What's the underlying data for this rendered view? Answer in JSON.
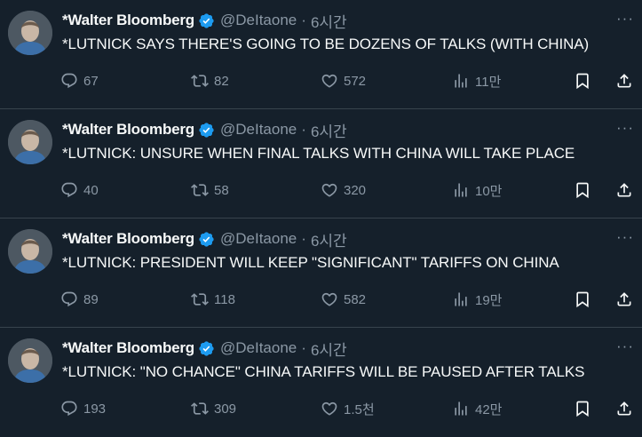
{
  "colors": {
    "background": "#15202b",
    "divider": "#38444d",
    "primary_text": "#f7f9f9",
    "secondary_text": "#8b98a5",
    "verified_badge": "#1d9bf0"
  },
  "icons": {
    "reply": "reply-icon",
    "retweet": "retweet-icon",
    "like": "heart-icon",
    "views": "views-icon",
    "bookmark": "bookmark-icon",
    "share": "share-icon",
    "more": "more-icon",
    "verified": "verified-badge-icon"
  },
  "more_label": "···",
  "tweets": [
    {
      "author_name": "*Walter Bloomberg",
      "handle": "@DeItaone",
      "separator": "·",
      "time": "6시간",
      "text": "*LUTNICK SAYS THERE'S GOING TO BE DOZENS OF TALKS (WITH CHINA)",
      "replies": "67",
      "retweets": "82",
      "likes": "572",
      "views": "11만"
    },
    {
      "author_name": "*Walter Bloomberg",
      "handle": "@DeItaone",
      "separator": "·",
      "time": "6시간",
      "text": "*LUTNICK: UNSURE WHEN FINAL TALKS WITH CHINA WILL TAKE PLACE",
      "replies": "40",
      "retweets": "58",
      "likes": "320",
      "views": "10만"
    },
    {
      "author_name": "*Walter Bloomberg",
      "handle": "@DeItaone",
      "separator": "·",
      "time": "6시간",
      "text": "*LUTNICK: PRESIDENT WILL KEEP \"SIGNIFICANT\" TARIFFS ON CHINA",
      "replies": "89",
      "retweets": "118",
      "likes": "582",
      "views": "19만"
    },
    {
      "author_name": "*Walter Bloomberg",
      "handle": "@DeItaone",
      "separator": "·",
      "time": "6시간",
      "text": "*LUTNICK: \"NO CHANCE\" CHINA TARIFFS WILL BE PAUSED AFTER TALKS",
      "replies": "193",
      "retweets": "309",
      "likes": "1.5천",
      "views": "42만"
    }
  ]
}
